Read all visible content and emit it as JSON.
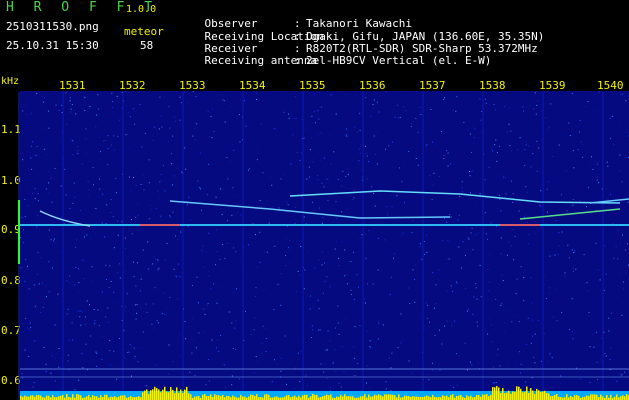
{
  "header": {
    "app_title": "H R O F F T",
    "version": "1.0.0",
    "file_name": "2510311530.png",
    "datetime": "25.10.31 15:30",
    "detection_label": "meteor",
    "detection_count": "58",
    "info_rows": [
      {
        "label": "Observer",
        "sep": ":",
        "value": "Takanori Kawachi"
      },
      {
        "label": "Receiving Location",
        "sep": ":",
        "value": "Ogaki, Gifu, JAPAN (136.60E, 35.35N)"
      },
      {
        "label": "Receiver",
        "sep": ":",
        "value": "R820T2(RTL-SDR) SDR-Sharp 53.372MHz"
      },
      {
        "label": "Receiving antenna",
        "sep": ":",
        "value": "2el-HB9CV Vertical (el. E-W)"
      }
    ]
  },
  "spectrogram": {
    "y_unit": "kHz",
    "x_ticks": [
      "1531",
      "1532",
      "1533",
      "1534",
      "1535",
      "1536",
      "1537",
      "1538",
      "1539",
      "1540"
    ],
    "y_ticks": [
      "1.1",
      "1.0",
      "0.9",
      "0.8",
      "0.7",
      "0.6"
    ],
    "colors": {
      "background": "#050a80",
      "axis_text": "#f2f200",
      "carrier": "#33ccff",
      "level_bar": "#f2f200",
      "level_base": "#00a8ff"
    }
  }
}
